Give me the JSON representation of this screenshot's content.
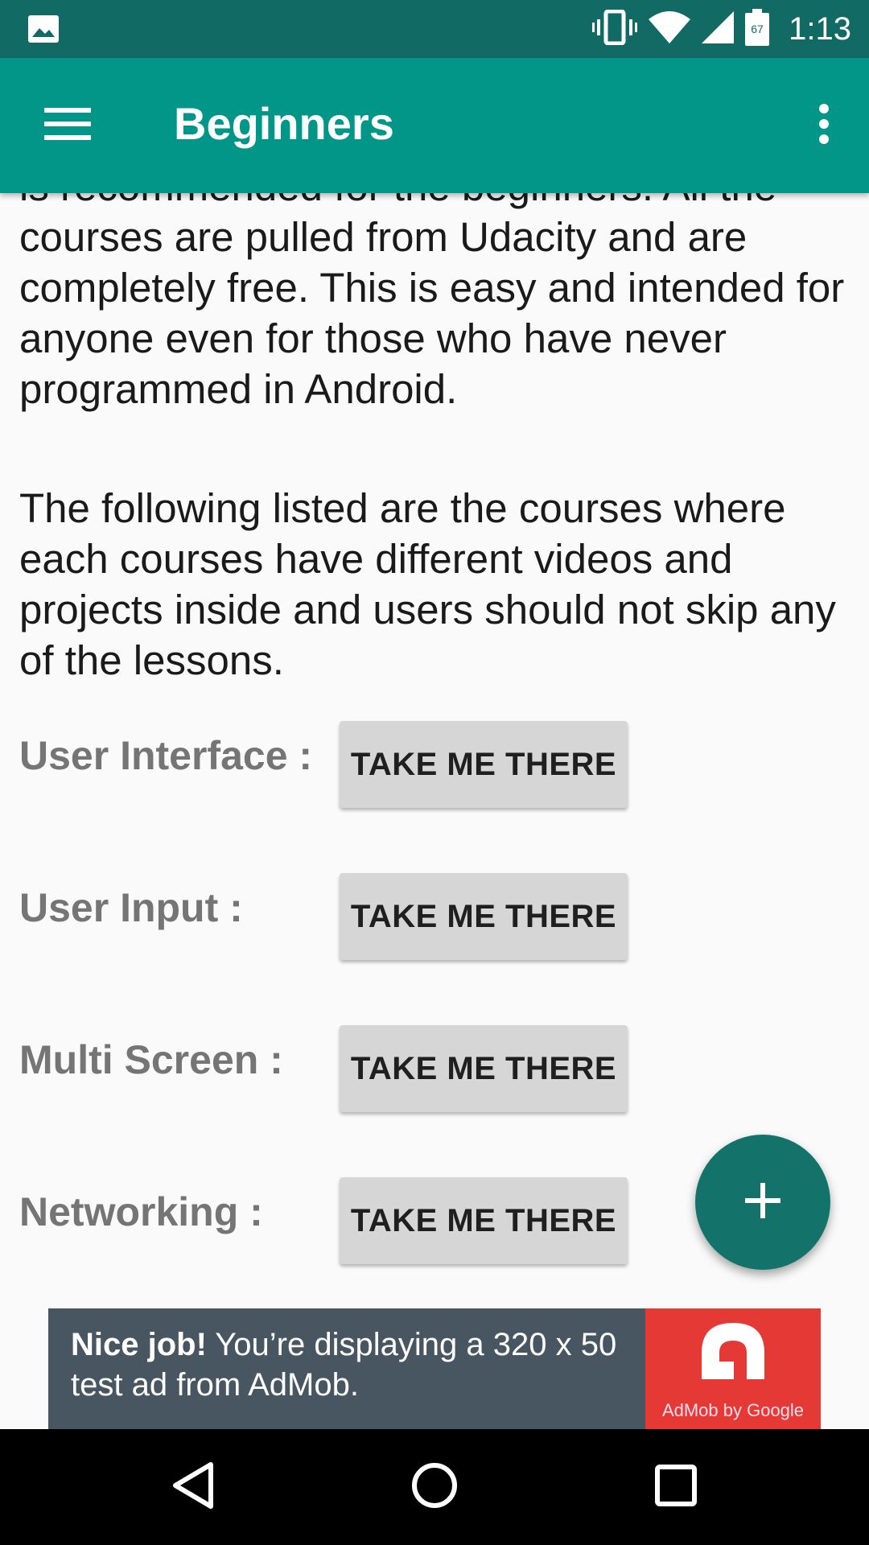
{
  "status_bar": {
    "time": "1:13",
    "battery_level": "67",
    "icons": [
      "image-icon",
      "vibrate-icon",
      "wifi-icon",
      "signal-icon",
      "battery-icon"
    ]
  },
  "app_bar": {
    "title": "Beginners",
    "icons": [
      "menu-icon",
      "more-vert-icon"
    ],
    "color": "#019688"
  },
  "content": {
    "intro_paragraph": "is recommended for the beginners. All the courses are pulled from Udacity and are completely free. This is easy and intended for anyone even for those who have never programmed in Android.",
    "courses_paragraph": "The following listed are the courses where each courses have different videos and projects inside and users should not skip any of the lessons.",
    "courses": [
      {
        "label": "User Interface :",
        "button": "TAKE ME THERE"
      },
      {
        "label": "User Input :",
        "button": "TAKE ME THERE"
      },
      {
        "label": "Multi Screen :",
        "button": "TAKE ME THERE"
      },
      {
        "label": "Networking :",
        "button": "TAKE ME THERE"
      }
    ]
  },
  "fab": {
    "icon": "plus-icon",
    "color": "#13736b"
  },
  "ad": {
    "bold_text": "Nice job!",
    "text": " You’re displaying a 320 x 50 test ad from AdMob.",
    "logo_caption": "AdMob by Google"
  },
  "nav_bar": {
    "icons": [
      "back-icon",
      "home-icon",
      "recents-icon"
    ]
  }
}
